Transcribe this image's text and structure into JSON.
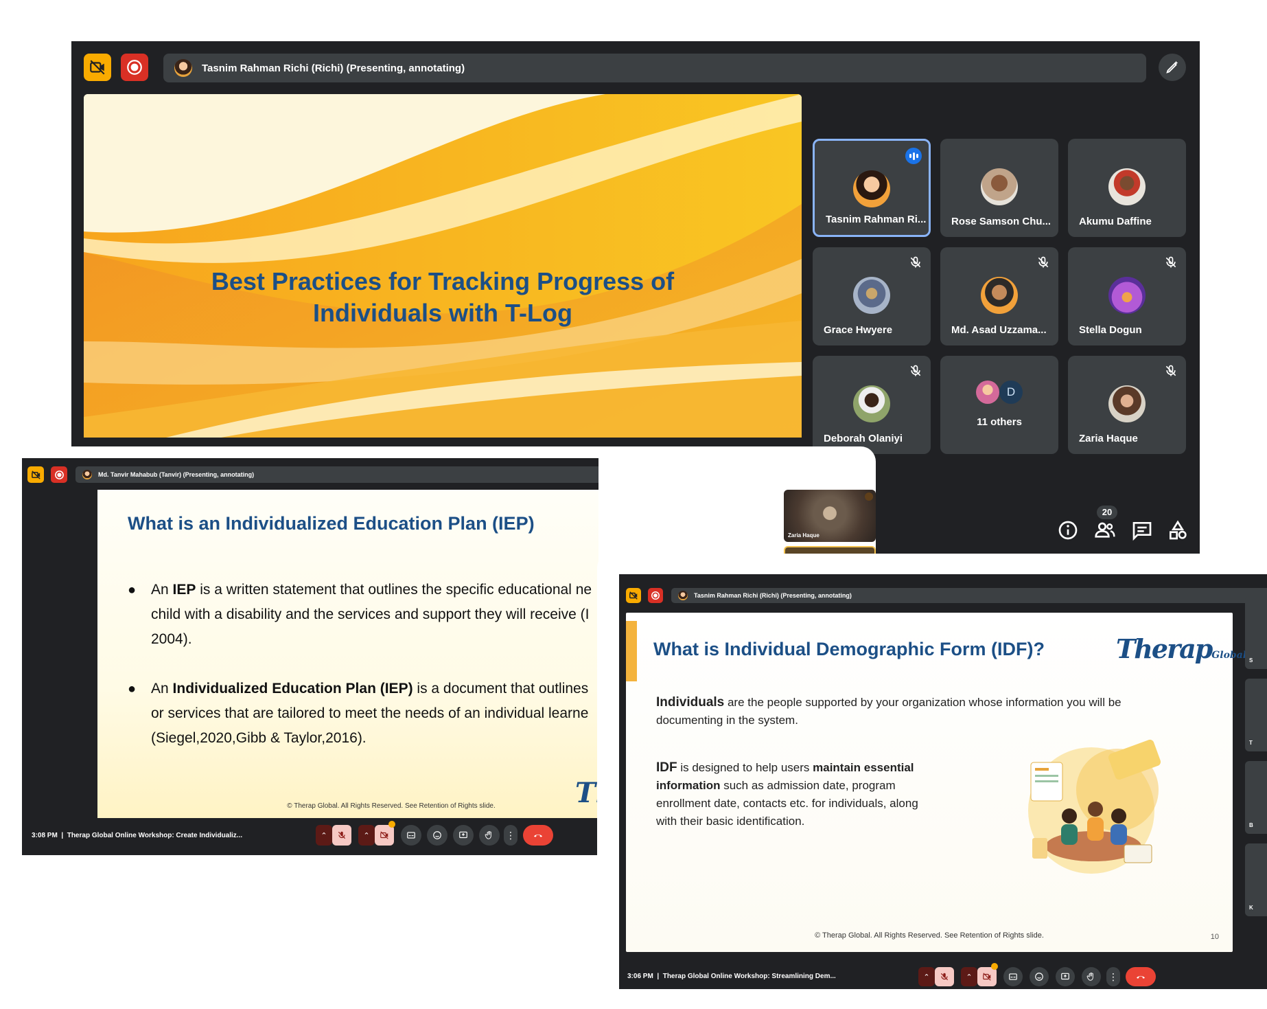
{
  "window_top": {
    "presenter_label": "Tasnim Rahman Richi (Richi) (Presenting, annotating)",
    "slide_title_line1": "Best Practices for Tracking Progress of",
    "slide_title_line2": "Individuals with T-Log",
    "participants": [
      {
        "name": "Tasnim Rahman Ri...",
        "speaking": true,
        "muted": false
      },
      {
        "name": "Rose Samson Chu...",
        "speaking": false,
        "muted": false
      },
      {
        "name": "Akumu Daffine",
        "speaking": false,
        "muted": false
      },
      {
        "name": "Grace Hwyere",
        "speaking": false,
        "muted": true
      },
      {
        "name": "Md. Asad Uzzama...",
        "speaking": false,
        "muted": true
      },
      {
        "name": "Stella Dogun",
        "speaking": false,
        "muted": true
      },
      {
        "name": "Deborah Olaniyi",
        "speaking": false,
        "muted": true
      },
      {
        "name": "Zaria Haque",
        "speaking": false,
        "muted": true
      }
    ],
    "others_label": "11 others",
    "others_initial": "D",
    "people_count": "20",
    "colors": {
      "record": "#d93025",
      "camera_off": "#f9ab00",
      "active_border": "#8ab4f8"
    }
  },
  "window_middle": {
    "presenter_label": "Md. Tanvir Mahabub (Tanvir) (Presenting, annotating)",
    "self_tile_name": "Zaria Haque",
    "slide_title": "What is an Individualized Education Plan (IEP)",
    "bullet1": {
      "pre": "An ",
      "bold": "IEP",
      "post_line1": " is a written statement that outlines the specific educational ne",
      "line2": "child with a disability and the services and support they will receive (I",
      "line3": "2004)."
    },
    "bullet2": {
      "pre": "An ",
      "bold": "Individualized Education Plan (IEP)",
      "post_line1": " is a document that outlines",
      "line2": "or services that are tailored to meet the needs of an individual learne",
      "line3": "(Siegel,2020,Gibb & Taylor,2016)."
    },
    "footer": "© Therap Global. All Rights Reserved. See Retention of Rights slide.",
    "logo_fragment": "Th",
    "time": "3:08 PM",
    "meeting_title": "Therap Global Online Workshop: Create Individualiz..."
  },
  "window_bottom": {
    "presenter_label": "Tasnim Rahman Richi (Richi) (Presenting, annotating)",
    "slide_title": "What is Individual Demographic Form (IDF)?",
    "logo_text": "Therap",
    "logo_suffix": "Global",
    "para1_bold": "Individuals",
    "para1_line1": " are the people supported by your organization whose information you will be",
    "para1_line2": "documenting in the system.",
    "para2_bold1": "IDF",
    "para2_t1": " is  designed  to  help  users ",
    "para2_bold2": "maintain  essential",
    "para2_bold3": "information",
    "para2_t2": "  such  as  admission  date,  program",
    "para2_line3": "enrollment  date,  contacts  etc.  for  individuals,  along",
    "para2_line4": "with their basic identification.",
    "footer": "© Therap Global. All Rights Reserved. See Retention of Rights slide.",
    "page_number": "10",
    "side_letters": [
      "S",
      "T",
      "B",
      "K"
    ],
    "time": "3:06 PM",
    "meeting_title": "Therap Global Online Workshop: Streamlining Dem..."
  },
  "icons": [
    "camera-off-icon",
    "record-icon",
    "annotate-pen-icon",
    "mic-off-icon",
    "speaking-icon",
    "info-icon",
    "people-icon",
    "chat-icon",
    "activities-icon",
    "chevron-up-icon",
    "camera-icon",
    "captions-icon",
    "emoji-icon",
    "present-icon",
    "raise-hand-icon",
    "more-icon",
    "end-call-icon"
  ]
}
